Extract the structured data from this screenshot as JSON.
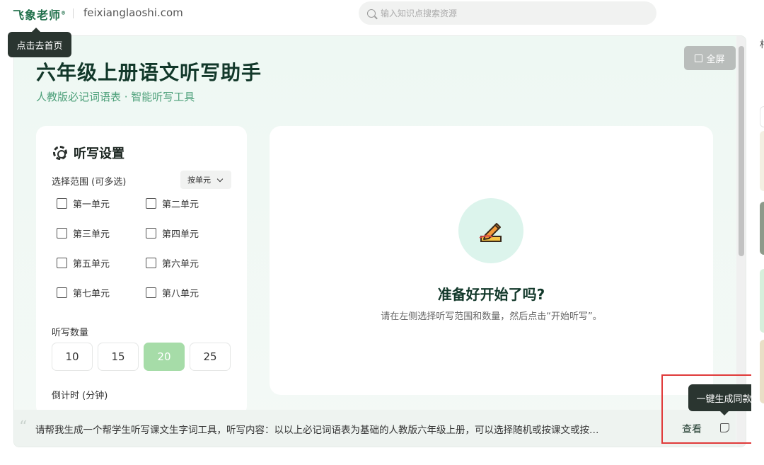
{
  "header": {
    "logo": "飞象老师",
    "logo_mark": "®",
    "site_url": "feixianglaoshi.com",
    "search_placeholder": "输入知识点搜索资源"
  },
  "tooltips": {
    "home": "点击去首页",
    "generate": "一键生成同款"
  },
  "app": {
    "title": "六年级上册语文听写助手",
    "subtitle": "人教版必记词语表 · 智能听写工具",
    "fullscreen_label": "全屏"
  },
  "settings": {
    "title": "听写设置",
    "range_label": "选择范围 (可多选)",
    "mode_select": "按单元",
    "units": [
      "第一单元",
      "第二单元",
      "第三单元",
      "第四单元",
      "第五单元",
      "第六单元",
      "第七单元",
      "第八单元"
    ],
    "count_label": "听写数量",
    "counts": [
      "10",
      "15",
      "20",
      "25"
    ],
    "selected_count": "20",
    "timer_label": "倒计时 (分钟)"
  },
  "result": {
    "title": "准备好开始了吗?",
    "description": "请在左侧选择听写范围和数量，然后点击“开始听写”。",
    "icon": "pencil-writing-icon"
  },
  "prompt": {
    "quote_mark": "“",
    "text": "请帮我生成一个帮学生听写课文生字词工具，听写内容：以以上必记词语表为基础的人教版六年级上册，可以选择随机或按课文或按…",
    "view_label": "查看"
  },
  "right_edge": {
    "char": "相"
  },
  "colors": {
    "brand_green": "#1f6f4a",
    "accent_green": "#a6dca8",
    "highlight_red": "#e03a3a"
  }
}
